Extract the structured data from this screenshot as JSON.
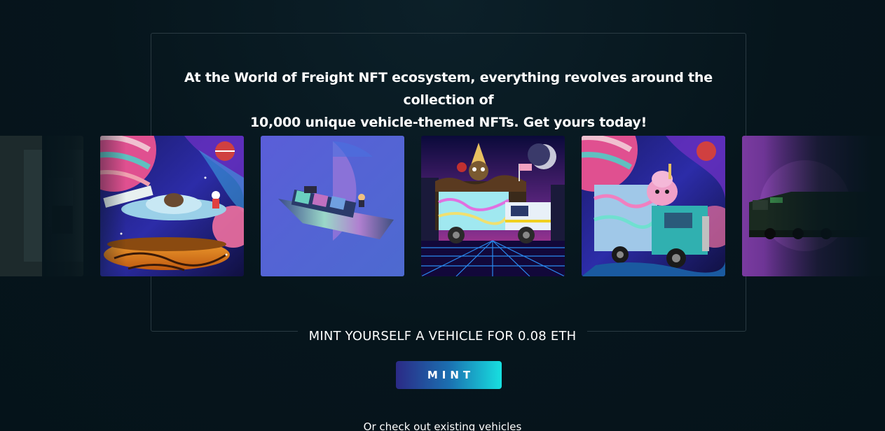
{
  "hero": {
    "headline_line1": "At the World of Freight NFT ecosystem, everything revolves around the collection of",
    "headline_line2": "10,000 unique vehicle-themed NFTs. Get yours today!"
  },
  "carousel": {
    "items": [
      {
        "subject": "dark truck (partially visible)"
      },
      {
        "subject": "flying saucer over space planet"
      },
      {
        "subject": "container ship on purple background"
      },
      {
        "subject": "ice cream van in synthwave city"
      },
      {
        "subject": "semi truck with ice cream character"
      },
      {
        "subject": "dark train locomotive (partially visible)"
      }
    ]
  },
  "mint": {
    "label": "MINT YOURSELF A VEHICLE FOR 0.08 ETH",
    "button_label": "MINT",
    "button_gradient": [
      "#2b2a86",
      "#17e0e0"
    ]
  },
  "footer": {
    "existing_link": "Or check out existing vehicles"
  },
  "colors": {
    "background": "#06151c",
    "frame_border": "#2a3a42",
    "text": "#ffffff"
  }
}
